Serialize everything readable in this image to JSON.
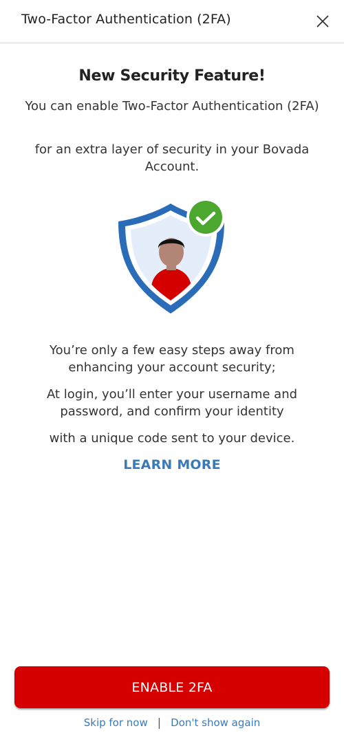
{
  "header": {
    "title": "Two-Factor Authentication (2FA)",
    "close_icon": "close-icon"
  },
  "main": {
    "heading": "New Security Feature!",
    "paragraphs": [
      "You can enable Two-Factor Authentication (2FA)",
      "for an extra layer of security in your Bovada Account.",
      "You’re only a few easy steps away from enhancing your account security;",
      "At login, you’ll enter your username and password, and confirm your identity",
      "with a unique code sent to your device."
    ],
    "illustration": "shield-user-check-illustration",
    "learn_more": "LEARN MORE"
  },
  "actions": {
    "enable_label": "ENABLE 2FA",
    "skip_label": "Skip for now",
    "separator": "|",
    "dont_show_label": "Don't show again"
  },
  "colors": {
    "primary_button": "#d50000",
    "link": "#3a7ab8",
    "shield_blue": "#2b6cb8",
    "check_green": "#4ba72e"
  }
}
